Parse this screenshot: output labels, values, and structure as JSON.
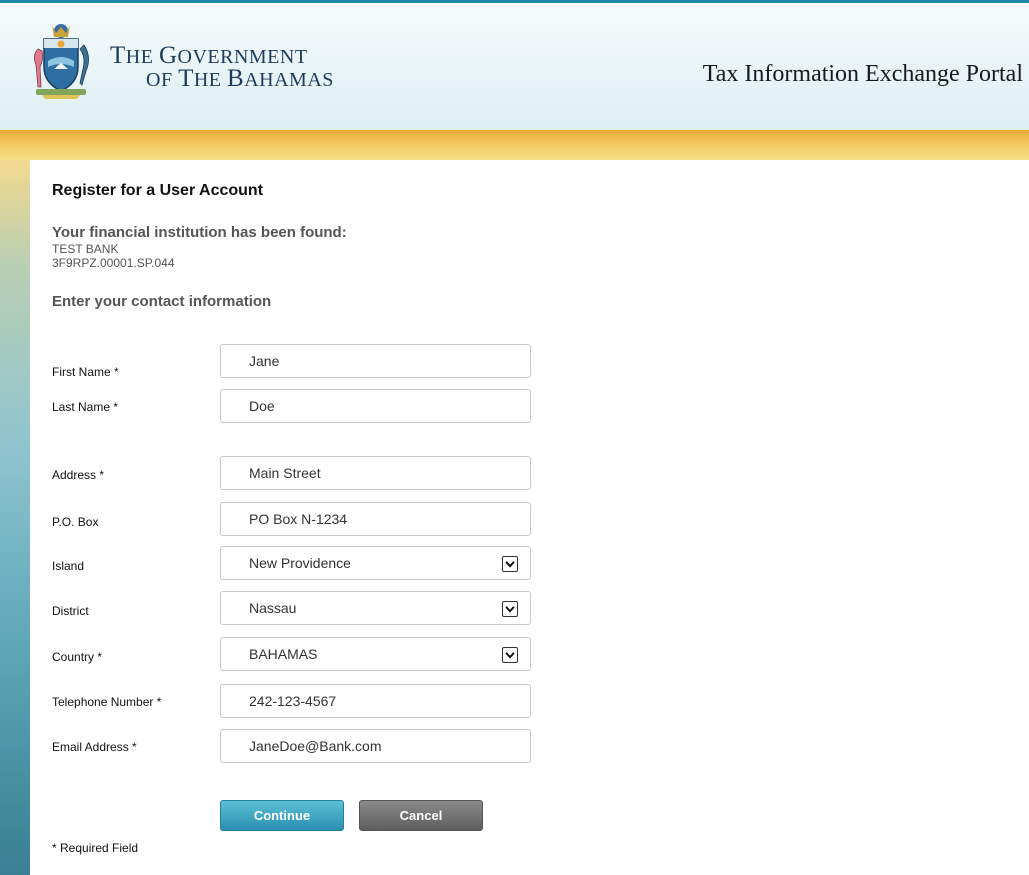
{
  "header": {
    "logo_line1_cap1": "T",
    "logo_line1_rest1": "HE ",
    "logo_line1_cap2": "G",
    "logo_line1_rest2": "OVERNMENT",
    "logo_line2_pre": "OF ",
    "logo_line2_cap1": "T",
    "logo_line2_rest1": "HE ",
    "logo_line2_cap2": "B",
    "logo_line2_rest2": "AHAMAS",
    "portal_title": "Tax Information Exchange Portal"
  },
  "page": {
    "heading": "Register for a User Account",
    "found_heading": "Your financial institution has been found:",
    "institution_name": "TEST BANK",
    "institution_id": "3F9RPZ.00001.SP.044",
    "contact_heading": "Enter your contact information"
  },
  "form": {
    "first_name": {
      "label": "First Name *",
      "value": "Jane"
    },
    "last_name": {
      "label": "Last Name *",
      "value": "Doe"
    },
    "address": {
      "label": "Address *",
      "value": "Main Street"
    },
    "po_box": {
      "label": "P.O. Box",
      "value": "PO Box N-1234"
    },
    "island": {
      "label": "Island",
      "value": "New Providence"
    },
    "district": {
      "label": "District",
      "value": "Nassau"
    },
    "country": {
      "label": "Country *",
      "value": "BAHAMAS"
    },
    "telephone": {
      "label": "Telephone Number *",
      "value": "242-123-4567"
    },
    "email": {
      "label": "Email Address *",
      "value": "JaneDoe@Bank.com"
    }
  },
  "buttons": {
    "continue": "Continue",
    "cancel": "Cancel"
  },
  "footer": {
    "required_note": "* Required Field"
  },
  "colors": {
    "accent_teal": "#2a8fae",
    "gold": "#e9a93a",
    "cancel_gray": "#5e5e5e"
  }
}
